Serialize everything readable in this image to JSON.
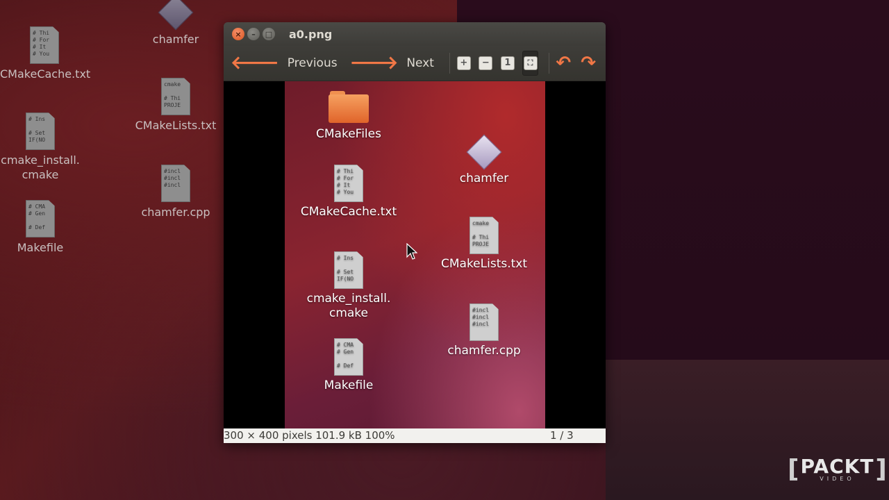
{
  "desktop": {
    "icons": [
      {
        "label": "CMakeCache.txt",
        "lines": [
          "# Thi",
          "# For",
          "# It",
          "# You"
        ]
      },
      {
        "label_line1": "cmake_install.",
        "label_line2": "cmake",
        "lines": [
          "# Ins",
          "",
          "# Set",
          "IF(NO"
        ]
      },
      {
        "label": "Makefile",
        "lines": [
          "# CMA",
          "# Gen",
          "",
          "# Def"
        ]
      },
      {
        "label": "chamfer"
      },
      {
        "label": "CMakeLists.txt",
        "lines": [
          "cmake",
          "",
          "# Thi",
          "PROJE"
        ]
      },
      {
        "label": "chamfer.cpp",
        "lines": [
          "#incl",
          "#incl",
          "#incl"
        ]
      }
    ]
  },
  "window": {
    "title": "a0.png",
    "toolbar": {
      "previous_label": "Previous",
      "next_label": "Next",
      "zoom_in_symbol": "+",
      "zoom_out_symbol": "−",
      "normal_size_symbol": "1",
      "best_fit_symbol": "⛶",
      "rotate_left_symbol": "↶",
      "rotate_right_symbol": "↷"
    },
    "image_icons": [
      {
        "label": "CMakeFiles"
      },
      {
        "label": "CMakeCache.txt",
        "lines": [
          "# Thi",
          "# For",
          "# It",
          "# You"
        ]
      },
      {
        "label_line1": "cmake_install.",
        "label_line2": "cmake",
        "lines": [
          "# Ins",
          "",
          "# Set",
          "IF(NO"
        ]
      },
      {
        "label": "Makefile",
        "lines": [
          "# CMA",
          "# Gen",
          "",
          "# Def"
        ]
      },
      {
        "label": "chamfer"
      },
      {
        "label": "CMakeLists.txt",
        "lines": [
          "cmake",
          "",
          "# Thi",
          "PROJE"
        ]
      },
      {
        "label": "chamfer.cpp",
        "lines": [
          "#incl",
          "#incl",
          "#incl"
        ]
      }
    ],
    "status": {
      "info": "300 × 400 pixels  101.9 kB    100%",
      "position": "1 / 3"
    }
  },
  "logo": {
    "main": "PACKT",
    "sub": "VIDEO"
  },
  "colors": {
    "accent": "#f07746",
    "brand_green": "#7ac143"
  }
}
